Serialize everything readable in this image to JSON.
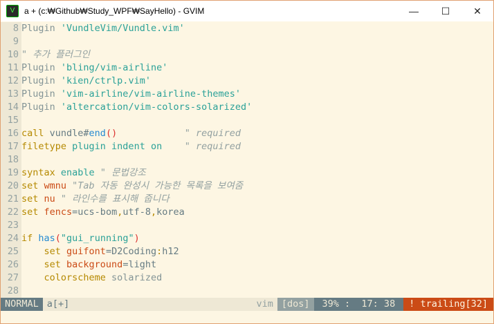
{
  "window": {
    "title": "a + (c:₩Github₩Study_WPF₩SayHello) - GVIM",
    "minimize": "—",
    "maximize": "☐",
    "close": "✕"
  },
  "lines": [
    {
      "n": "8",
      "tokens": [
        [
          "Plugin ",
          "g"
        ],
        [
          "'VundleVim/Vundle.vim'",
          "s"
        ]
      ]
    },
    {
      "n": "9",
      "tokens": []
    },
    {
      "n": "10",
      "tokens": [
        [
          "\" 추가 플러그인",
          "c"
        ]
      ]
    },
    {
      "n": "11",
      "tokens": [
        [
          "Plugin ",
          "g"
        ],
        [
          "'bling/vim-airline'",
          "s"
        ]
      ]
    },
    {
      "n": "12",
      "tokens": [
        [
          "Plugin ",
          "g"
        ],
        [
          "'kien/ctrlp.vim'",
          "s"
        ]
      ]
    },
    {
      "n": "13",
      "tokens": [
        [
          "Plugin ",
          "g"
        ],
        [
          "'vim-airline/vim-airline-themes'",
          "s"
        ]
      ]
    },
    {
      "n": "14",
      "tokens": [
        [
          "Plugin ",
          "g"
        ],
        [
          "'altercation/vim-colors-solarized'",
          "s"
        ]
      ]
    },
    {
      "n": "15",
      "tokens": []
    },
    {
      "n": "16",
      "tokens": [
        [
          "call",
          "k"
        ],
        [
          " vundle#",
          "n"
        ],
        [
          "end",
          "b"
        ],
        [
          "()",
          "r"
        ],
        [
          "            ",
          "n"
        ],
        [
          "\" required",
          "c"
        ]
      ]
    },
    {
      "n": "17",
      "tokens": [
        [
          "filetype",
          "k"
        ],
        [
          " plugin indent on",
          "s"
        ],
        [
          "    ",
          "n"
        ],
        [
          "\" required",
          "c"
        ]
      ]
    },
    {
      "n": "18",
      "tokens": []
    },
    {
      "n": "19",
      "tokens": [
        [
          "syntax",
          "k"
        ],
        [
          " enable",
          "s"
        ],
        [
          " \" 문법강조",
          "c"
        ]
      ]
    },
    {
      "n": "20",
      "tokens": [
        [
          "set",
          "k"
        ],
        [
          " wmnu",
          "o"
        ],
        [
          " \"Tab 자동 완성시 가능한 목록을 보여줌",
          "c"
        ]
      ]
    },
    {
      "n": "21",
      "tokens": [
        [
          "set",
          "k"
        ],
        [
          " nu",
          "o"
        ],
        [
          " \" 라인수를 표시해 줍니다",
          "c"
        ]
      ]
    },
    {
      "n": "22",
      "tokens": [
        [
          "set",
          "k"
        ],
        [
          " fencs",
          "o"
        ],
        [
          "=ucs-bom",
          "n"
        ],
        [
          ",",
          "k"
        ],
        [
          "utf-8",
          "n"
        ],
        [
          ",",
          "k"
        ],
        [
          "korea",
          "n"
        ]
      ]
    },
    {
      "n": "23",
      "tokens": []
    },
    {
      "n": "24",
      "tokens": [
        [
          "if",
          "k"
        ],
        [
          " has",
          "b"
        ],
        [
          "(",
          "r"
        ],
        [
          "\"gui_running\"",
          "s"
        ],
        [
          ")",
          "r"
        ]
      ]
    },
    {
      "n": "25",
      "tokens": [
        [
          "    set",
          "k"
        ],
        [
          " guifont",
          "o"
        ],
        [
          "=D2Coding",
          "n"
        ],
        [
          ":",
          "k"
        ],
        [
          "h12",
          "n"
        ]
      ]
    },
    {
      "n": "26",
      "tokens": [
        [
          "    set",
          "k"
        ],
        [
          " background",
          "o"
        ],
        [
          "=light",
          "n"
        ]
      ]
    },
    {
      "n": "27",
      "tokens": [
        [
          "    colorscheme",
          "k"
        ],
        [
          " solarized",
          "g"
        ]
      ]
    },
    {
      "n": "28",
      "tokens": []
    }
  ],
  "status": {
    "mode": "NORMAL",
    "file": "a[+]",
    "filetype": "vim",
    "format": "[dos]",
    "position": "39% :  17: 38",
    "warning": "! trailing[32]"
  },
  "colors": {
    "mode_bg": "#657b83",
    "warning_bg": "#cb4b16",
    "format_bg": "#93a1a1"
  }
}
